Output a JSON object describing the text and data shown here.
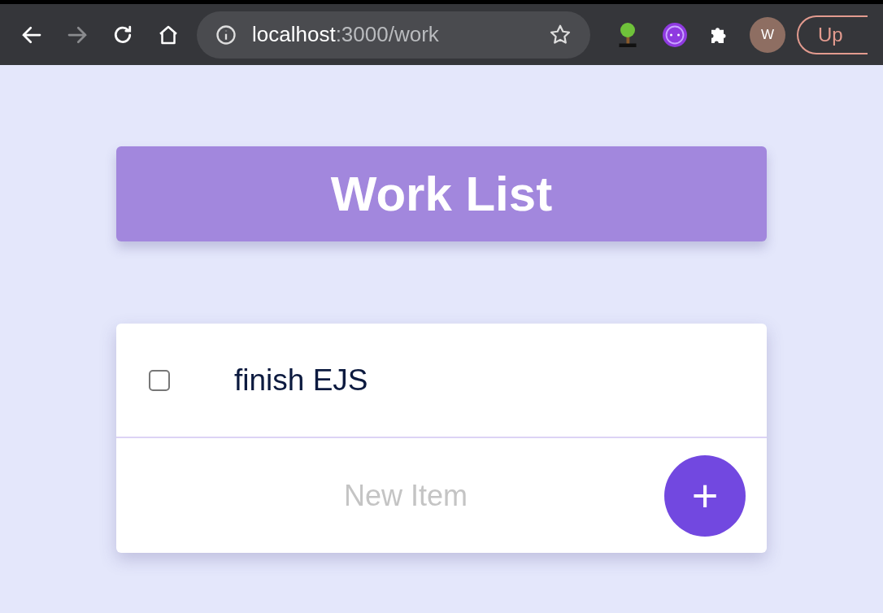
{
  "browser": {
    "back_disabled": false,
    "forward_disabled": true,
    "url_host": "localhost",
    "url_path": ":3000/work",
    "profile_initial": "W",
    "update_button": "Up"
  },
  "heading": "Work List",
  "items": [
    {
      "text": "finish EJS",
      "checked": false
    }
  ],
  "new_item": {
    "placeholder": "New Item",
    "add_button": "+"
  }
}
